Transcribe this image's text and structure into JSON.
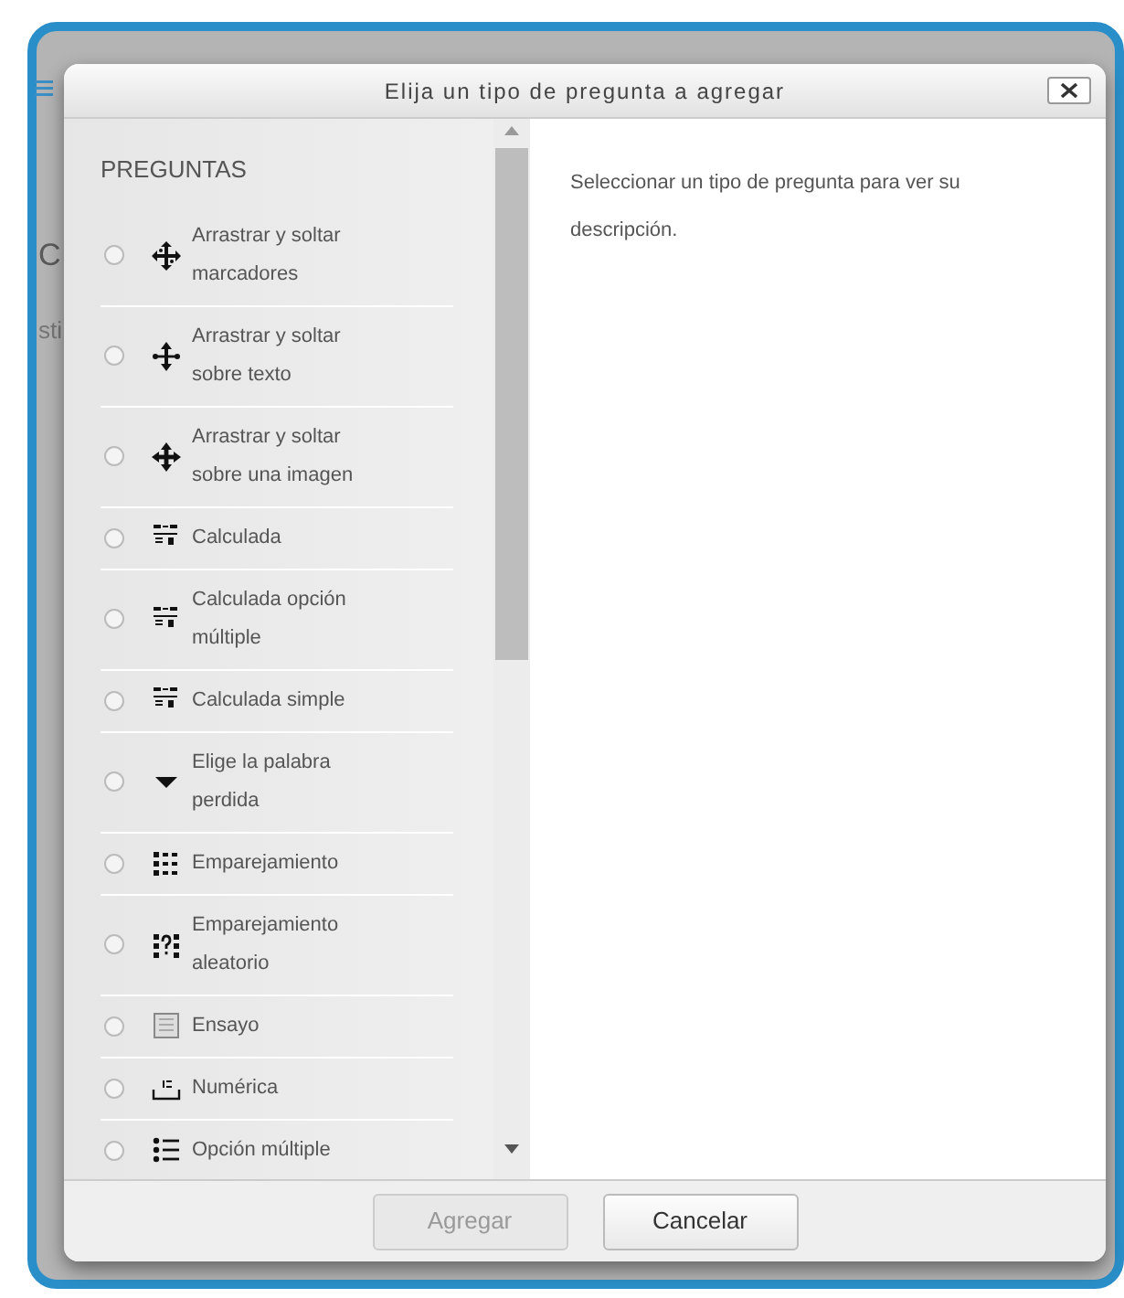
{
  "background": {
    "fragments": [
      "C",
      "sti"
    ]
  },
  "dialog": {
    "title": "Elija un tipo de pregunta a agregar",
    "list_heading": "PREGUNTAS",
    "question_types": [
      {
        "label": "Arrastrar y soltar marcadores",
        "kind": "move",
        "selected": false
      },
      {
        "label": "Arrastrar y soltar sobre texto",
        "kind": "vmove",
        "selected": false
      },
      {
        "label": "Arrastrar y soltar sobre una imagen",
        "kind": "cross",
        "selected": false
      },
      {
        "label": "Calculada",
        "kind": "calc",
        "selected": false
      },
      {
        "label": "Calculada opción múltiple",
        "kind": "calc",
        "selected": false
      },
      {
        "label": "Calculada simple",
        "kind": "calc",
        "selected": false
      },
      {
        "label": "Elige la palabra perdida",
        "kind": "caret",
        "selected": false
      },
      {
        "label": "Emparejamiento",
        "kind": "grid",
        "selected": false
      },
      {
        "label": "Emparejamiento aleatorio",
        "kind": "qgrid",
        "selected": false
      },
      {
        "label": "Ensayo",
        "kind": "doc",
        "selected": false
      },
      {
        "label": "Numérica",
        "kind": "numeric",
        "selected": false
      },
      {
        "label": "Opción múltiple",
        "kind": "list",
        "selected": false
      }
    ],
    "description": "Seleccionar un tipo de pregunta para ver su descripción.",
    "buttons": [
      {
        "label": "Agregar",
        "disabled": true
      },
      {
        "label": "Cancelar",
        "disabled": false
      }
    ]
  }
}
